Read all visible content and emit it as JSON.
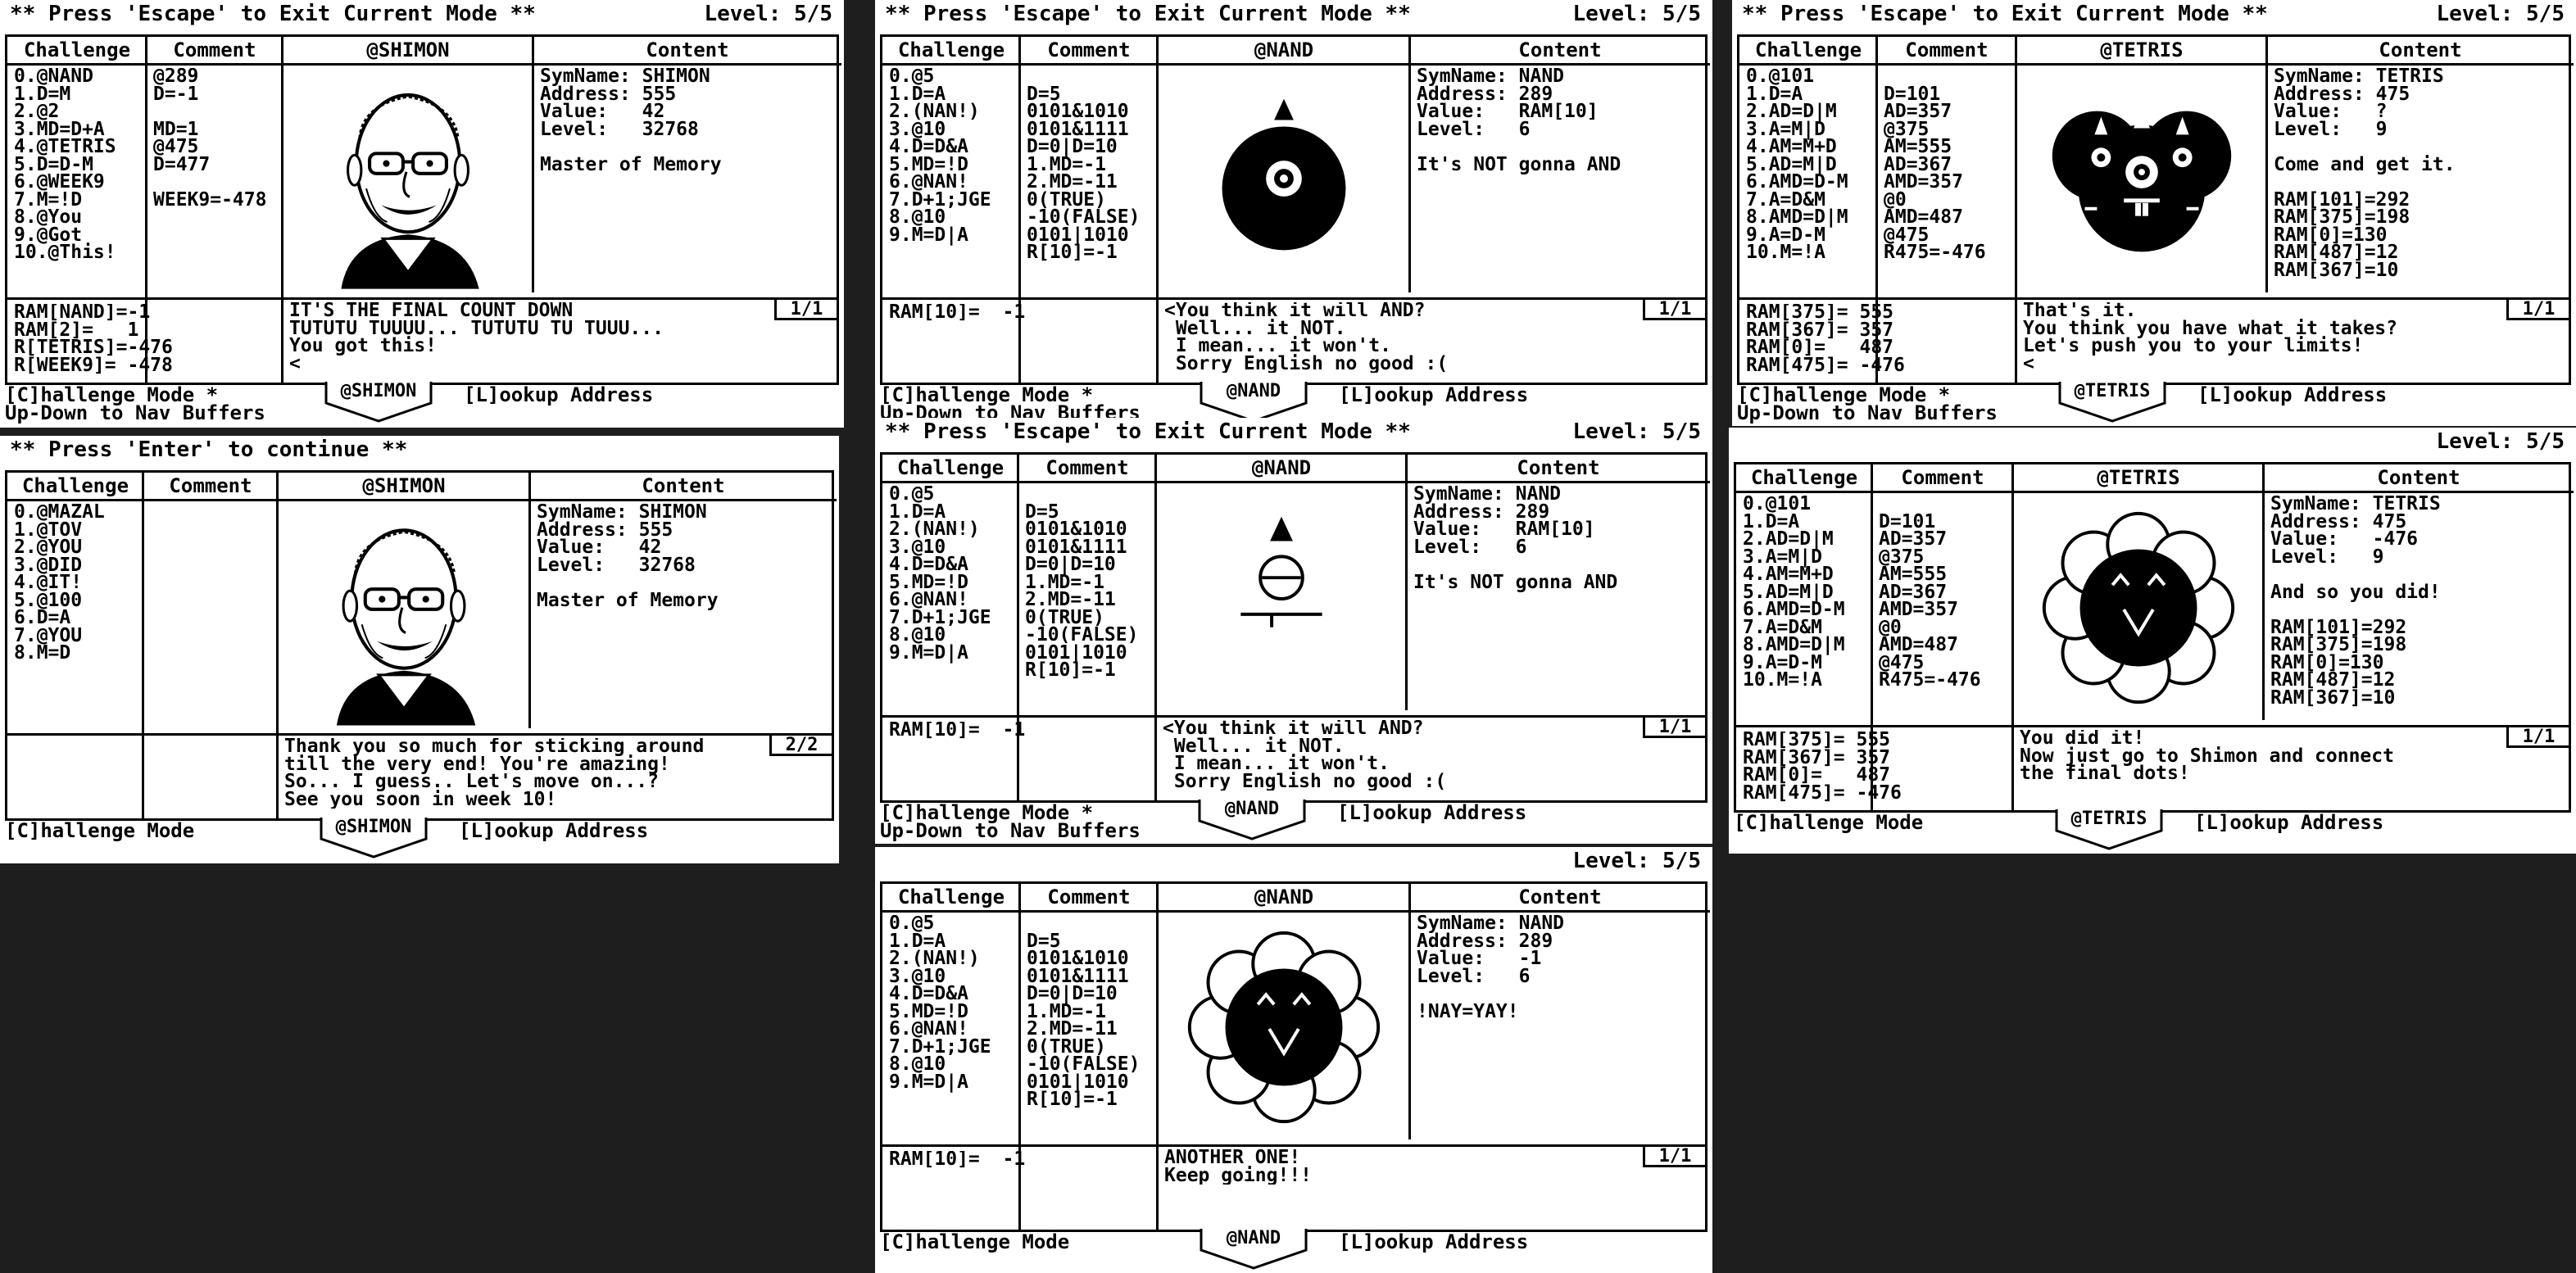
{
  "screens": [
    {
      "top_message": "** Press 'Escape' to Exit Current Mode **",
      "level": "Level: 5/5",
      "headers": {
        "challenge": "Challenge",
        "comment": "Comment",
        "symbol": "@SHIMON",
        "content": "Content"
      },
      "challenge": "0.@NAND\n1.D=M\n2.@2\n3.MD=D+A\n4.@TETRIS\n5.D=D-M\n6.@WEEK9\n7.M=!D\n8.@You\n9.@Got\n10.@This!",
      "comment": "@289\nD=-1\n\nMD=1\n@475\nD=477\n\nWEEK9=-478",
      "content": "SymName: SHIMON\nAddress: 555\nValue:   42\nLevel:   32768\n\nMaster of Memory",
      "ram": "RAM[NAND]=-1\nRAM[2]=   1\nR[TETRIS]=-476\nR[WEEK9]= -478",
      "dialog": "IT'S THE FINAL COUNT DOWN\nTUTUTU TUUUU... TUTUTU TU TUUU...\nYou got this!\n<",
      "page": "1/1",
      "mode": "[C]hallenge Mode *",
      "nav": "Up-Down to Nav Buffers",
      "tab": "@SHIMON",
      "lookup": "[L]ookup Address"
    },
    {
      "top_message": "** Press 'Escape' to Exit Current Mode **",
      "level": "Level: 5/5",
      "headers": {
        "challenge": "Challenge",
        "comment": "Comment",
        "symbol": "@NAND",
        "content": "Content"
      },
      "challenge": "0.@5\n1.D=A\n2.(NAN!)\n3.@10\n4.D=D&A\n5.MD=!D\n6.@NAN!\n7.D+1;JGE\n8.@10\n9.M=D|A",
      "comment": "\nD=5\n0101&1010\n0101&1111\nD=0|D=10\n1.MD=-1\n2.MD=-11\n0(TRUE)\n-10(FALSE)\n0101|1010\nR[10]=-1",
      "content": "SymName: NAND\nAddress: 289\nValue:   RAM[10]\nLevel:   6\n\nIt's NOT gonna AND",
      "ram": "RAM[10]=  -1",
      "dialog": "<You think it will AND?\n Well... it NOT.\n I mean... it won't.\n Sorry English no good :(",
      "page": "1/1",
      "mode": "[C]hallenge Mode *",
      "nav": "Up-Down to Nav Buffers",
      "tab": "@NAND",
      "lookup": "[L]ookup Address"
    },
    {
      "top_message": "** Press 'Escape' to Exit Current Mode **",
      "level": "Level: 5/5",
      "headers": {
        "challenge": "Challenge",
        "comment": "Comment",
        "symbol": "@TETRIS",
        "content": "Content"
      },
      "challenge": "0.@101\n1.D=A\n2.AD=D|M\n3.A=M|D\n4.AM=M+D\n5.AD=M|D\n6.AMD=D-M\n7.A=D&M\n8.AMD=D|M\n9.A=D-M\n10.M=!A",
      "comment": "\nD=101\nAD=357\n@375\nAM=555\nAD=367\nAMD=357\n@0\nAMD=487\n@475\nR475=-476",
      "content": "SymName: TETRIS\nAddress: 475\nValue:   ?\nLevel:   9\n\nCome and get it.\n\nRAM[101]=292\nRAM[375]=198\nRAM[0]=130\nRAM[487]=12\nRAM[367]=10",
      "ram": "RAM[375]= 555\nRAM[367]= 357\nRAM[0]=   487\nRAM[475]= -476",
      "dialog": "That's it.\nYou think you have what it takes?\nLet's push you to your limits!\n<",
      "page": "1/1",
      "mode": "[C]hallenge Mode *",
      "nav": "Up-Down to Nav Buffers",
      "tab": "@TETRIS",
      "lookup": "[L]ookup Address"
    },
    {
      "top_message": "** Press 'Enter' to continue **",
      "level": "",
      "headers": {
        "challenge": "Challenge",
        "comment": "Comment",
        "symbol": "@SHIMON",
        "content": "Content"
      },
      "challenge": "0.@MAZAL\n1.@TOV\n2.@YOU\n3.@DID\n4.@IT!\n5.@100\n6.D=A\n7.@YOU\n8.M=D",
      "comment": "",
      "content": "SymName: SHIMON\nAddress: 555\nValue:   42\nLevel:   32768\n\nMaster of Memory",
      "ram": "",
      "dialog": "Thank you so much for sticking around\ntill the very end! You're amazing!\nSo... I guess.. Let's move on...?\nSee you soon in week 10!",
      "page": "2/2",
      "mode": "[C]hallenge Mode",
      "nav": "",
      "tab": "@SHIMON",
      "lookup": "[L]ookup Address"
    },
    {
      "top_message": "** Press 'Escape' to Exit Current Mode **",
      "level": "Level: 5/5",
      "headers": {
        "challenge": "Challenge",
        "comment": "Comment",
        "symbol": "@NAND",
        "content": "Content"
      },
      "challenge": "0.@5\n1.D=A\n2.(NAN!)\n3.@10\n4.D=D&A\n5.MD=!D\n6.@NAN!\n7.D+1;JGE\n8.@10\n9.M=D|A",
      "comment": "\nD=5\n0101&1010\n0101&1111\nD=0|D=10\n1.MD=-1\n2.MD=-11\n0(TRUE)\n-10(FALSE)\n0101|1010\nR[10]=-1",
      "content": "SymName: NAND\nAddress: 289\nValue:   RAM[10]\nLevel:   6\n\nIt's NOT gonna AND",
      "ram": "RAM[10]=  -1",
      "dialog": "<You think it will AND?\n Well... it NOT.\n I mean... it won't.\n Sorry English no good :(",
      "page": "1/1",
      "mode": "[C]hallenge Mode *",
      "nav": "Up-Down to Nav Buffers",
      "tab": "@NAND",
      "lookup": "[L]ookup Address"
    },
    {
      "top_message": "",
      "level": "Level: 5/5",
      "headers": {
        "challenge": "Challenge",
        "comment": "Comment",
        "symbol": "@TETRIS",
        "content": "Content"
      },
      "challenge": "0.@101\n1.D=A\n2.AD=D|M\n3.A=M|D\n4.AM=M+D\n5.AD=M|D\n6.AMD=D-M\n7.A=D&M\n8.AMD=D|M\n9.A=D-M\n10.M=!A",
      "comment": "\nD=101\nAD=357\n@375\nAM=555\nAD=367\nAMD=357\n@0\nAMD=487\n@475\nR475=-476",
      "content": "SymName: TETRIS\nAddress: 475\nValue:   -476\nLevel:   9\n\nAnd so you did!\n\nRAM[101]=292\nRAM[375]=198\nRAM[0]=130\nRAM[487]=12\nRAM[367]=10",
      "ram": "RAM[375]= 555\nRAM[367]= 357\nRAM[0]=   487\nRAM[475]= -476",
      "dialog": "You did it!\nNow just go to Shimon and connect\nthe final dots!",
      "page": "1/1",
      "mode": "[C]hallenge Mode",
      "nav": "",
      "tab": "@TETRIS",
      "lookup": "[L]ookup Address"
    },
    {
      "top_message": "",
      "level": "Level: 5/5",
      "headers": {
        "challenge": "Challenge",
        "comment": "Comment",
        "symbol": "@NAND",
        "content": "Content"
      },
      "challenge": "0.@5\n1.D=A\n2.(NAN!)\n3.@10\n4.D=D&A\n5.MD=!D\n6.@NAN!\n7.D+1;JGE\n8.@10\n9.M=D|A",
      "comment": "\nD=5\n0101&1010\n0101&1111\nD=0|D=10\n1.MD=-1\n2.MD=-11\n0(TRUE)\n-10(FALSE)\n0101|1010\nR[10]=-1",
      "content": "SymName: NAND\nAddress: 289\nValue:   -1\nLevel:   6\n\n!NAY=YAY!",
      "ram": "RAM[10]=  -1",
      "dialog": "ANOTHER ONE!\nKeep going!!!",
      "page": "1/1",
      "mode": "[C]hallenge Mode",
      "nav": "",
      "tab": "@NAND",
      "lookup": "[L]ookup Address"
    }
  ]
}
